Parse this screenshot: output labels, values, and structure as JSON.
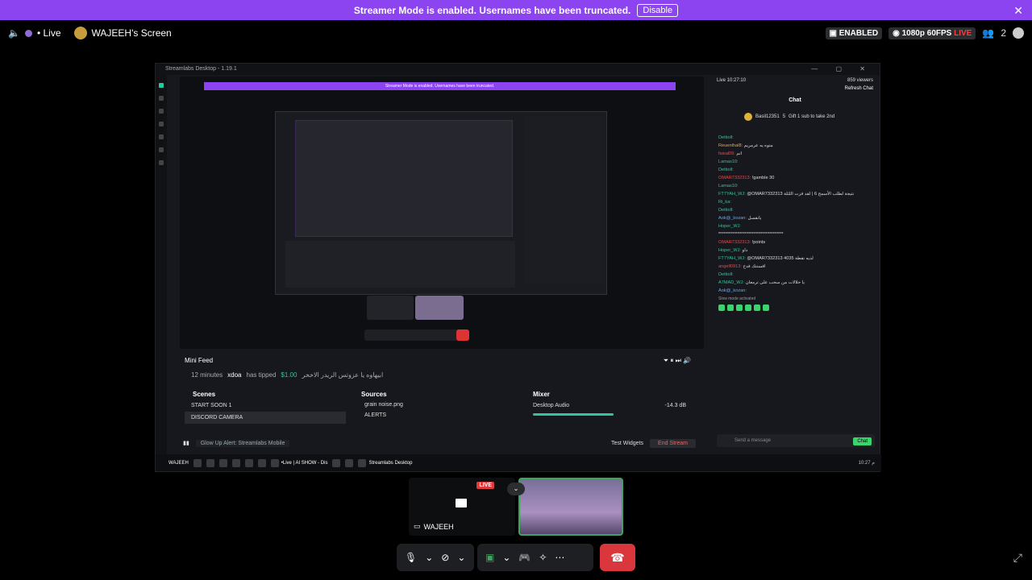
{
  "banner": {
    "text": "Streamer Mode is enabled. Usernames have been truncated.",
    "disable_label": "Disable",
    "close_glyph": "✕"
  },
  "topbar": {
    "live_label": "• Live",
    "screen_title": "WAJEEH's Screen",
    "enabled_label": "ENABLED",
    "quality_label": "1080p 60FPS",
    "live_badge": "LIVE",
    "viewer_count": "2"
  },
  "stream_window": {
    "title": "Streamlabs Desktop - 1.19.1",
    "inner_banner": "Streamer Mode is enabled. Usernames have been truncated."
  },
  "minifeed": {
    "title": "Mini Feed",
    "time": "12 minutes",
    "user": "xdoa",
    "action": "has tipped",
    "amount": "$1.00",
    "note": "ابيهاوه يا عزوتس الريدر الاخخر"
  },
  "scenes": {
    "title": "Scenes",
    "items": [
      "START SOON 1",
      "DISCORD CAMERA"
    ]
  },
  "sources": {
    "title": "Sources",
    "items": [
      "grain noise.png",
      "ALERTS"
    ]
  },
  "mixer": {
    "title": "Mixer",
    "channel": "Desktop Audio",
    "level": "-14.3 dB"
  },
  "statusbar": {
    "glow": "Glow Up Alert: Streamlabs Mobile",
    "test_widgets": "Test Widgets",
    "end_stream": "End Stream"
  },
  "taskbar": {
    "user": "WAJEEH",
    "app1": "•Live | AI SHOW - Dis",
    "app2": "Streamlabs Desktop",
    "time": "10:27 م"
  },
  "chat": {
    "live_time": "Live 10:27:10",
    "viewers": "859 viewers",
    "refresh": "Refresh Chat",
    "title": "Chat",
    "gift_user": "Basil12351",
    "gift_count": "5",
    "gift_text": "Gift 1 sub to take 2nd",
    "messages": [
      {
        "user": "Dettioll:",
        "text": "",
        "cls": "u-green"
      },
      {
        "user": "Reuenthal8:",
        "text": "متوه يه عرمريم",
        "cls": "u-orange"
      },
      {
        "user": "faisal09:",
        "text": "اتم",
        "cls": "u-red"
      },
      {
        "user": "Lamas10:",
        "text": "",
        "cls": "u-green"
      },
      {
        "user": "Dettioll:",
        "text": "",
        "cls": "u-green"
      },
      {
        "user": "OMAR7332313:",
        "text": "!gamble 30",
        "cls": "u-red"
      },
      {
        "user": "Lamas10:",
        "text": "",
        "cls": "u-green"
      },
      {
        "user": "FT7YAH_WJ:",
        "text": "@OMAR7332313 نتيجة لطلب الأسمح 6 | لقد فزت اللثلة",
        "cls": "u-green"
      },
      {
        "user": "Ri_ka:",
        "text": "",
        "cls": "u-green"
      },
      {
        "user": "Dettioll:",
        "text": "",
        "cls": "u-green"
      },
      {
        "user": "Aok@_kozan:",
        "text": "يانقسل",
        "cls": "u-blue"
      },
      {
        "user": "Hoper_WJ:",
        "text": "",
        "cls": "u-green"
      },
      {
        "user": "",
        "text": "*************************************",
        "cls": "u-green"
      },
      {
        "user": "OMAR7332313:",
        "text": "!points",
        "cls": "u-red"
      },
      {
        "user": "Hoper_WJ:",
        "text": "داو",
        "cls": "u-green"
      },
      {
        "user": "FT7YAH_WJ:",
        "text": "@OMAR7332313 4035 لديه نقطة",
        "cls": "u-green"
      },
      {
        "user": "angell0913:",
        "text": "افستنك فدح",
        "cls": "u-red"
      },
      {
        "user": "Dettioll:",
        "text": "",
        "cls": "u-green"
      },
      {
        "user": "A7MAD_WJ:",
        "text": "يا حلالات من سحب على ترمعان",
        "cls": "u-green"
      },
      {
        "user": "Aok@_kozan:",
        "text": "",
        "cls": "u-blue"
      }
    ],
    "slow_mode": "Slow mode activated",
    "input_placeholder": "Send a message",
    "chat_button": "Chat"
  },
  "participants": {
    "screen_name": "WAJEEH",
    "live_badge": "LIVE"
  },
  "colors": {
    "banner": "#8c43f0",
    "accent_green": "#31c3a2",
    "end_call": "#da373c"
  }
}
